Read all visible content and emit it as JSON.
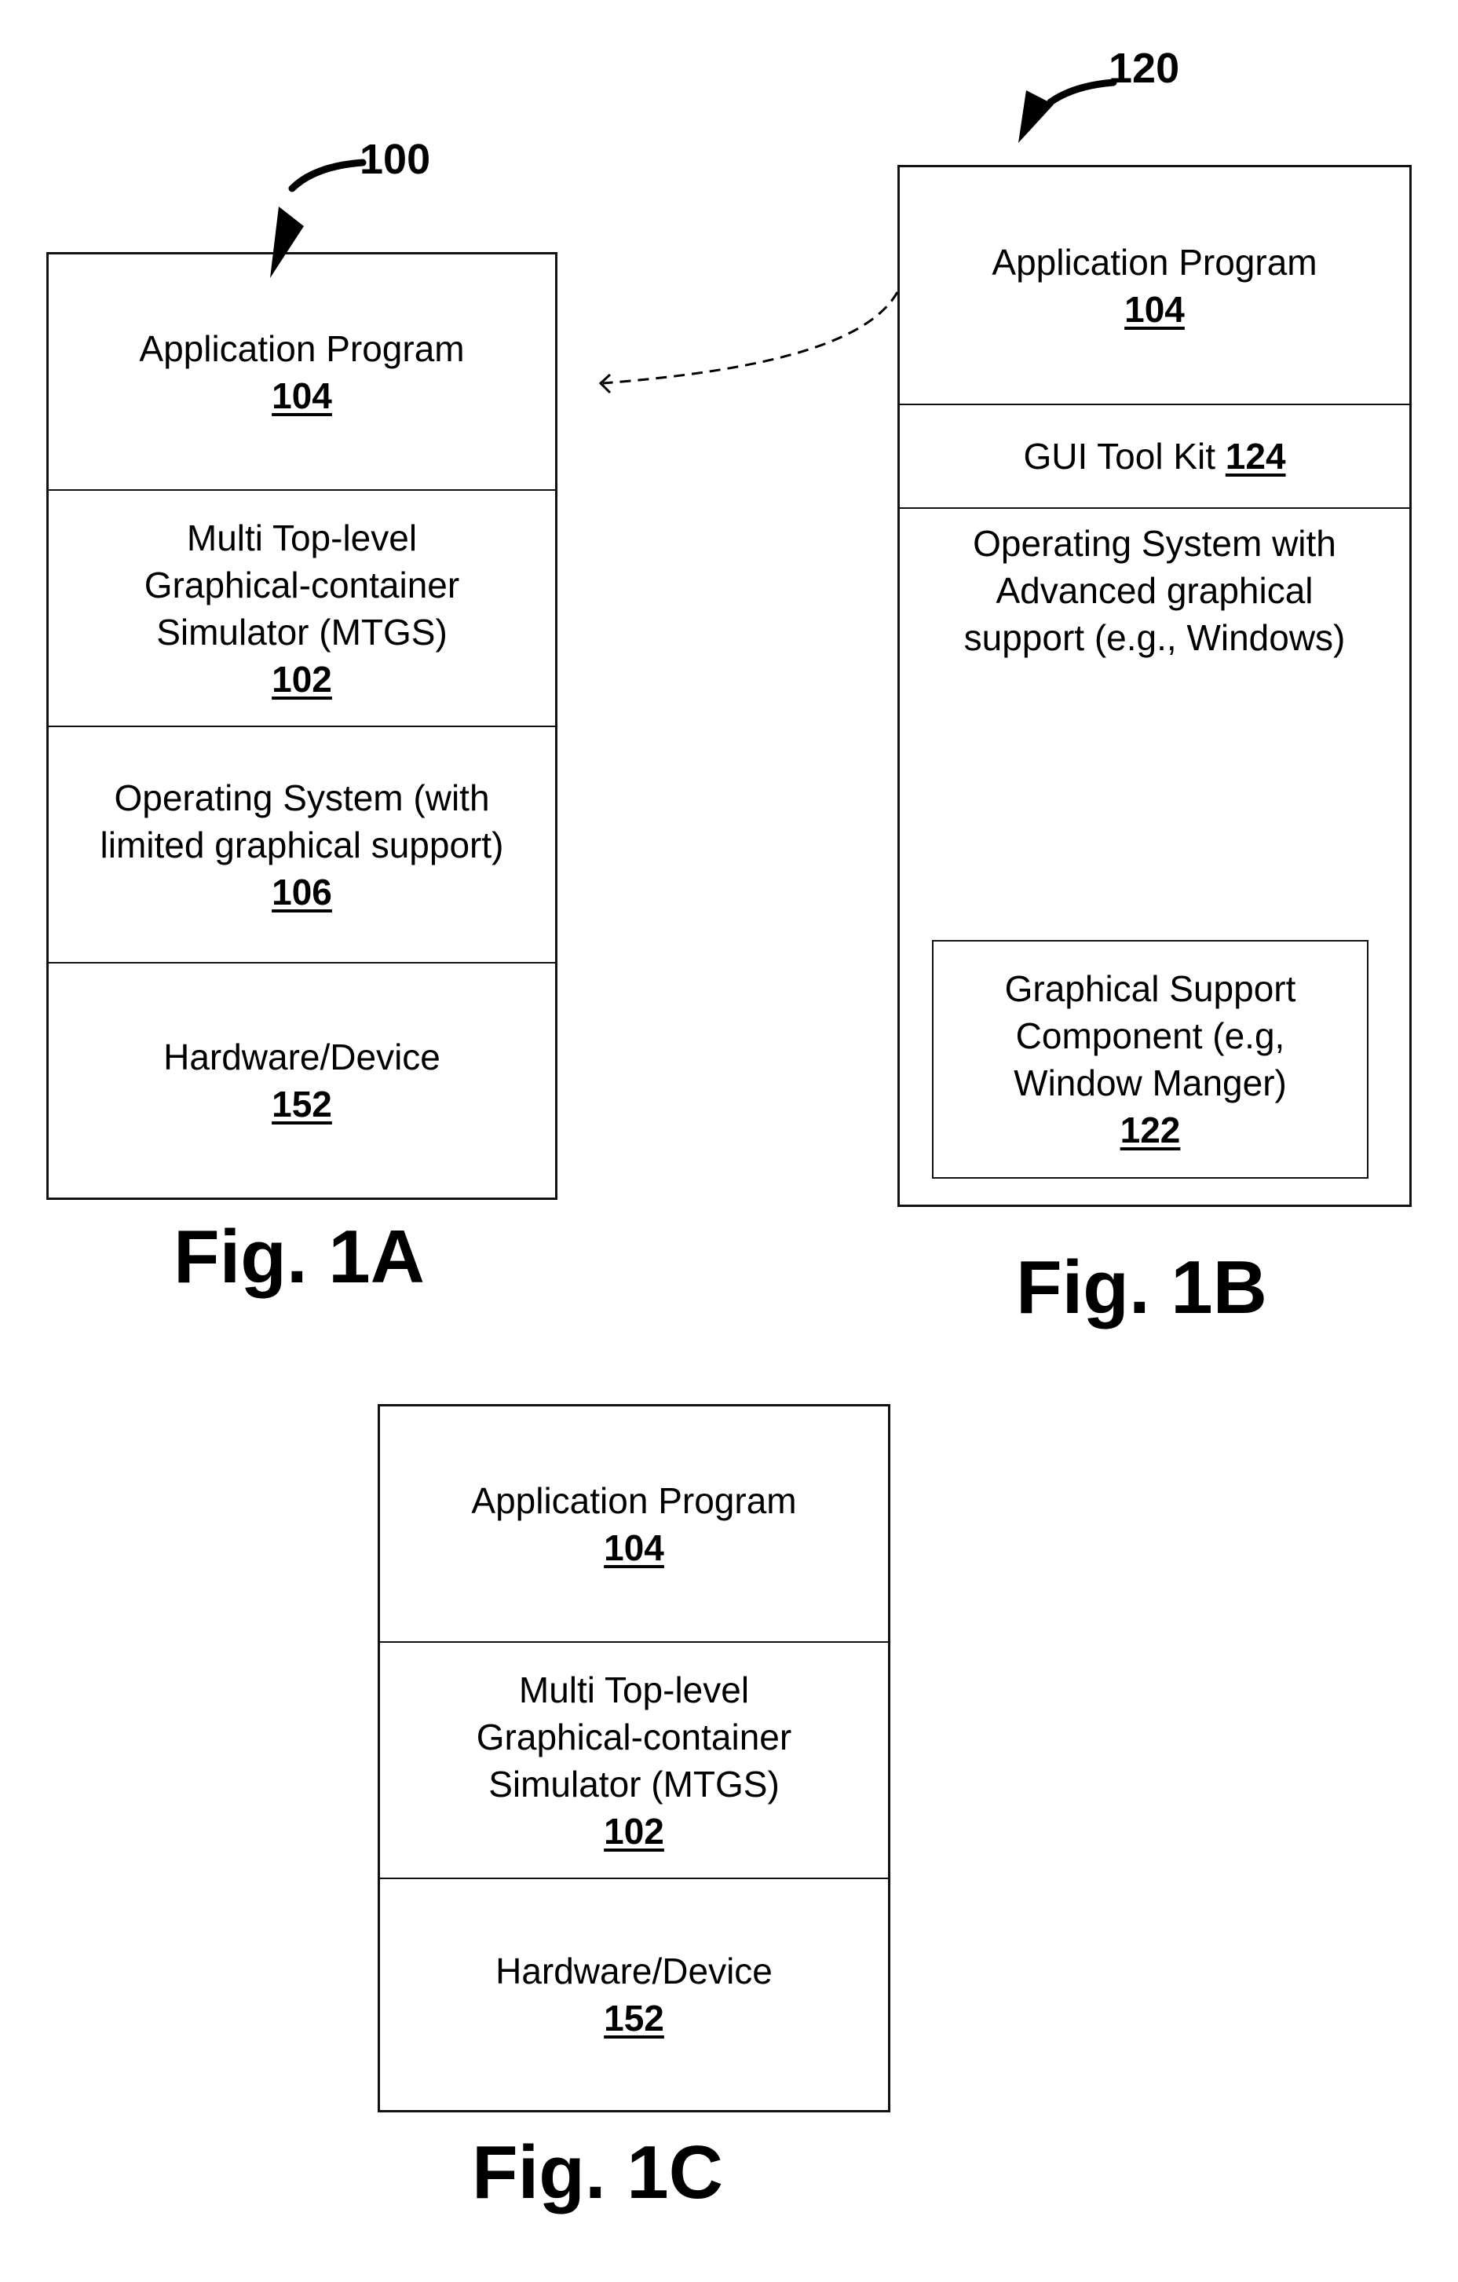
{
  "figures": {
    "fig1a": {
      "caption": "Fig. 1A",
      "ref": "100",
      "layers": [
        {
          "lines": [
            "Application Program"
          ],
          "ref": "104"
        },
        {
          "lines": [
            "Multi Top-level",
            "Graphical-container",
            "Simulator (MTGS)"
          ],
          "ref": "102"
        },
        {
          "lines": [
            "Operating System (with",
            "limited graphical support)"
          ],
          "ref": "106"
        },
        {
          "lines": [
            "Hardware/Device"
          ],
          "ref": "152"
        }
      ]
    },
    "fig1b": {
      "caption": "Fig. 1B",
      "ref": "120",
      "layers": [
        {
          "lines": [
            "Application Program"
          ],
          "ref": "104"
        },
        {
          "text": "GUI Tool Kit",
          "ref": "124"
        },
        {
          "lines": [
            "Operating System with",
            "Advanced graphical",
            "support (e.g., Windows)"
          ]
        }
      ],
      "inner": {
        "lines": [
          "Graphical Support",
          "Component (e.g,",
          "Window Manger)"
        ],
        "ref": "122"
      }
    },
    "fig1c": {
      "caption": "Fig. 1C",
      "layers": [
        {
          "lines": [
            "Application Program"
          ],
          "ref": "104"
        },
        {
          "lines": [
            "Multi Top-level",
            "Graphical-container",
            "Simulator (MTGS)"
          ],
          "ref": "102"
        },
        {
          "lines": [
            "Hardware/Device"
          ],
          "ref": "152"
        }
      ]
    }
  }
}
